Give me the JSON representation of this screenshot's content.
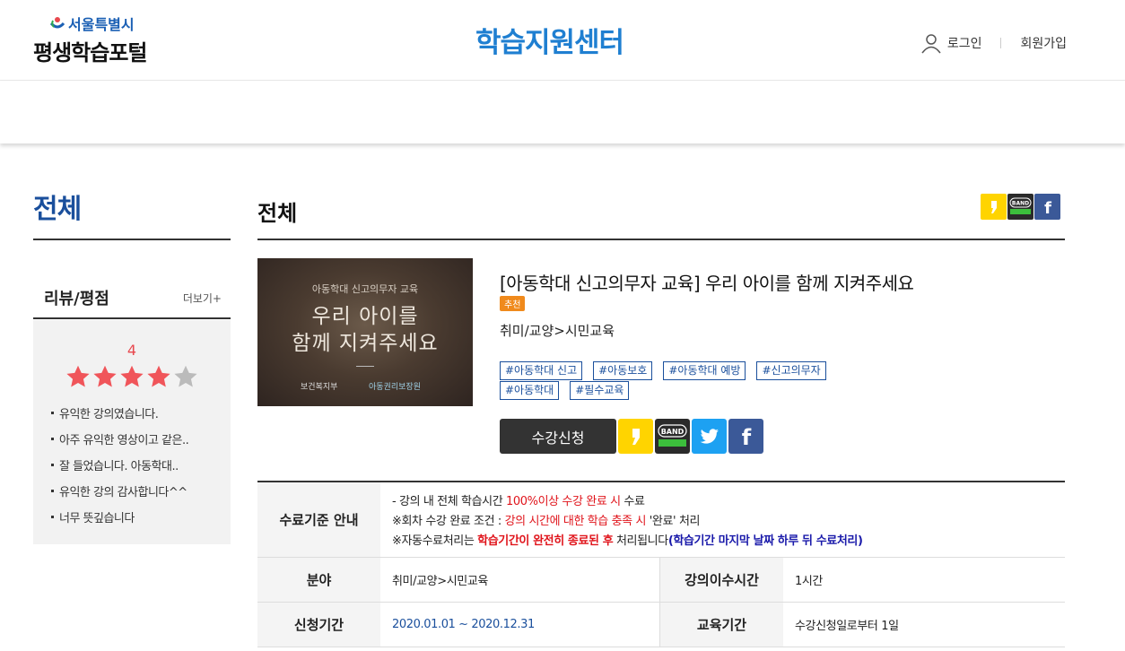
{
  "header": {
    "logo_city": "서울특별시",
    "logo_name": "평생학습포털",
    "site_title": "학습지원센터",
    "login": "로그인",
    "signup": "회원가입"
  },
  "sidebar": {
    "title": "전체",
    "review_title": "리뷰/평점",
    "review_more": "더보기+",
    "rating": "4",
    "rating_value": 4,
    "rating_max": 5,
    "reviews": [
      "유익한 강의였습니다.",
      "아주 유익한 영상이고 같은..",
      "잘 들었습니다. 아동학대..",
      "유익한 강의 감사합니다^^",
      "너무 뜻깊습니다"
    ]
  },
  "main": {
    "title": "전체",
    "share_icons": [
      "kakaostory-icon",
      "band-icon",
      "facebook-icon"
    ],
    "thumbnail": {
      "subtitle": "아동학대 신고의무자 교육",
      "line1": "우리 아이를",
      "line2": "함께 지켜주세요",
      "org1": "보건복지부",
      "org2": "아동권리보장원"
    },
    "course_title": "[아동학대 신고의무자 교육] 우리 아이를 함께 지켜주세요",
    "badge": "추천",
    "category": "취미/교양>시민교육",
    "tags": [
      "#아동학대 신고",
      "#아동보호",
      "#아동학대 예방",
      "#신고의무자",
      "#아동학대",
      "#필수교육"
    ],
    "enroll_label": "수강신청",
    "band_label": "BAND"
  },
  "info": {
    "completion_label": "수료기준 안내",
    "line1_a": "- 강의 내 전체 학습시간 ",
    "line1_b": "100%이상 수강 완료 시",
    "line1_c": " 수료",
    "line2_a": "※회차 수강 완료 조건 : ",
    "line2_b": "강의 시간에 대한 학습 충족 시",
    "line2_c": " '완료' 처리",
    "line3_a": "※자동수료처리는 ",
    "line3_b": "학습기간이 완전히 종료된 후",
    "line3_c": " 처리됩니다",
    "line3_d": "(학습기간 마지막 날짜 하루 뒤 수료처리)",
    "field_label": "분야",
    "field_value": "취미/교양>시민교육",
    "hours_label": "강의이수시간",
    "hours_value": "1시간",
    "apply_label": "신청기간",
    "apply_value": "2020.01.01 ~ 2020.12.31",
    "edu_label": "교육기간",
    "edu_value": "수강신청일로부터 1일"
  },
  "colors": {
    "brand_blue": "#1f7fd1",
    "kakao_yellow": "#ffd400",
    "band_dark": "#333333",
    "twitter": "#1da1f2",
    "facebook": "#3b5998",
    "star_filled": "#f0555a",
    "star_empty": "#bbbbbb"
  }
}
